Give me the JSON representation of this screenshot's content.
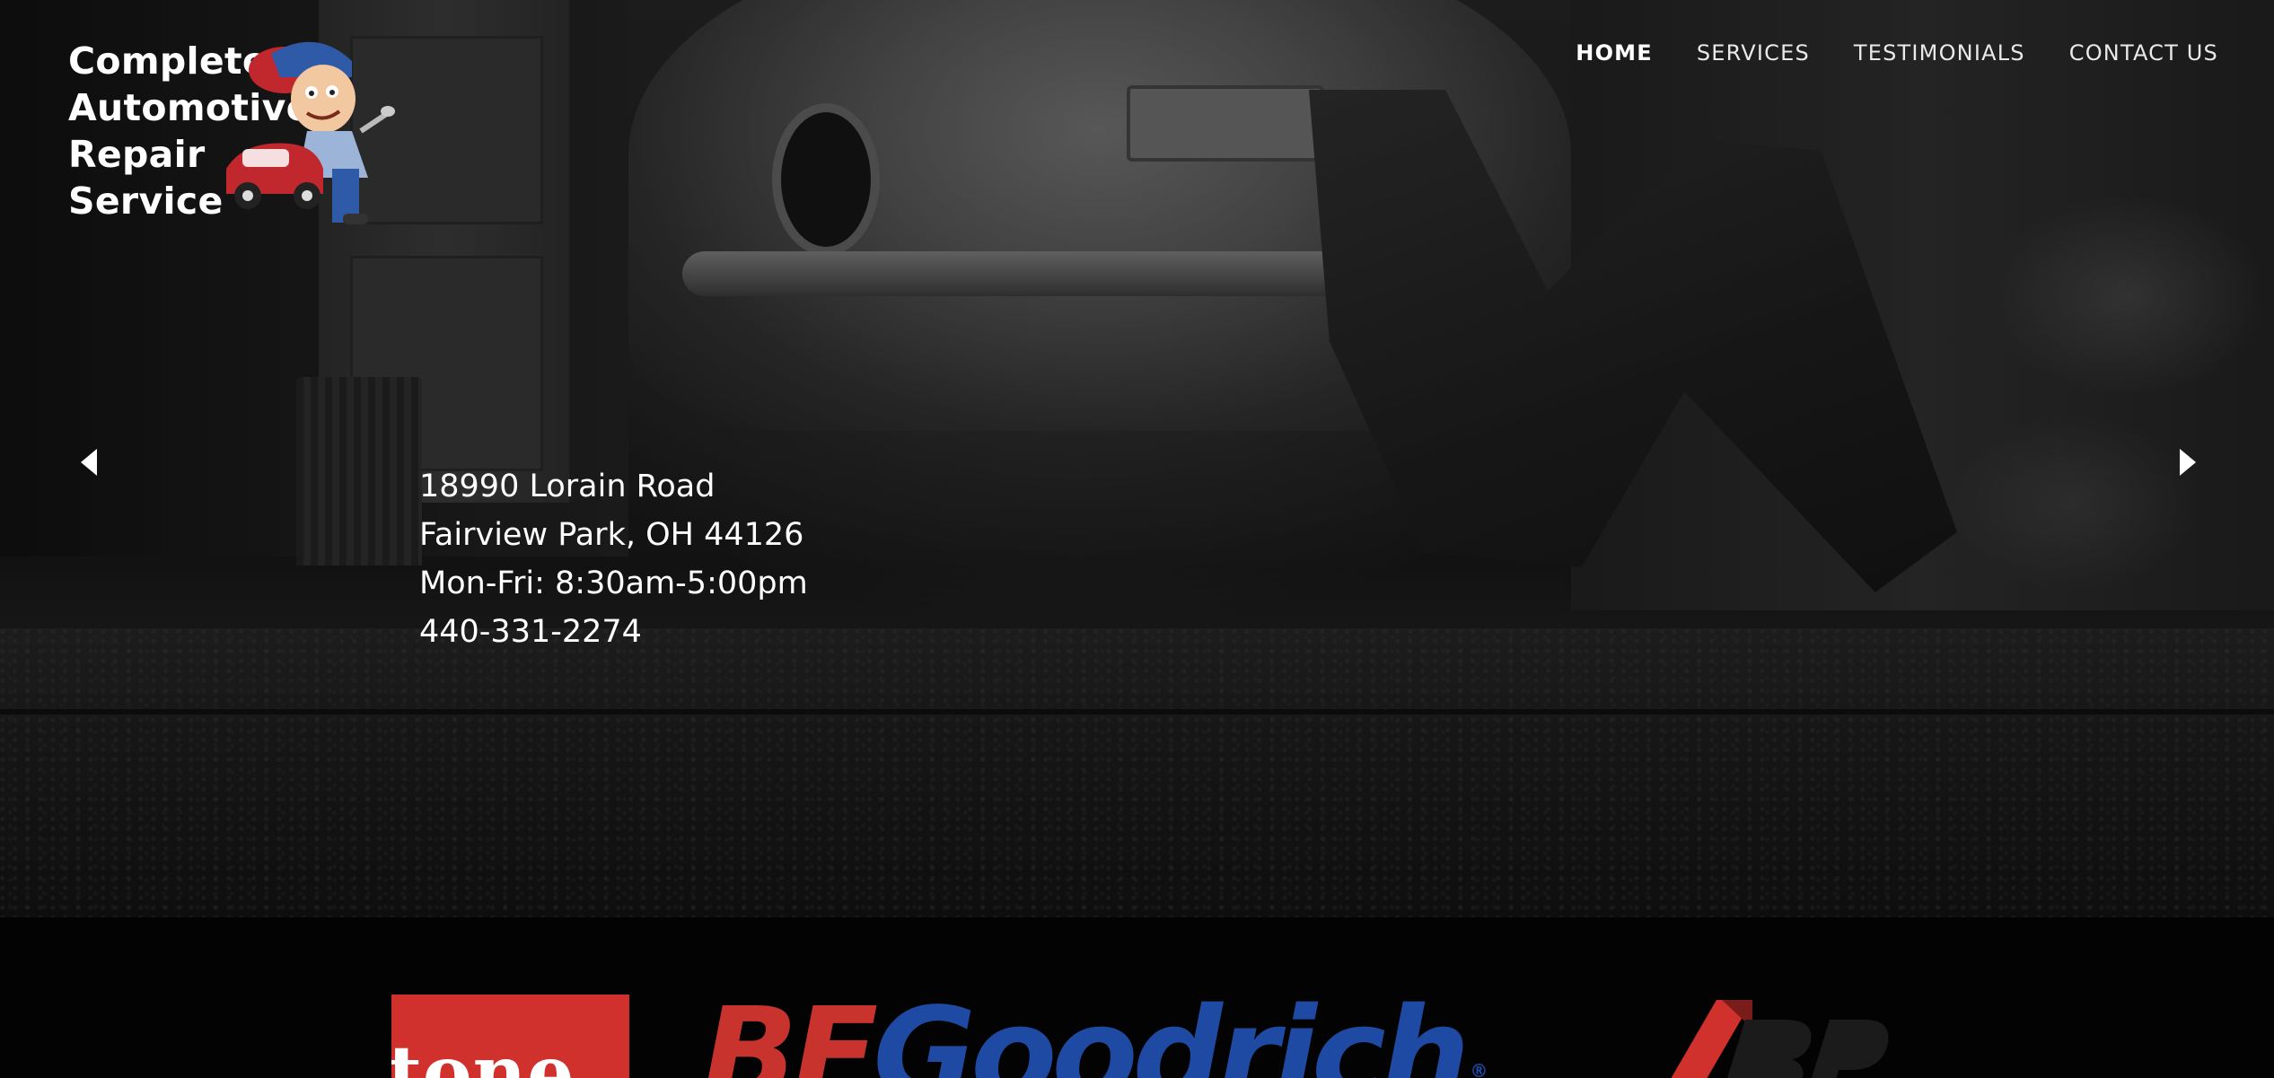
{
  "brand": {
    "logo_lines": [
      "Complete",
      "Automotive",
      "Repair",
      "Service"
    ]
  },
  "nav": {
    "items": [
      {
        "label": "HOME",
        "active": true
      },
      {
        "label": "SERVICES",
        "active": false
      },
      {
        "label": "TESTIMONIALS",
        "active": false
      },
      {
        "label": "CONTACT US",
        "active": false
      }
    ]
  },
  "slider": {
    "prev_icon": "triangle-left-icon",
    "next_icon": "triangle-right-icon"
  },
  "info": {
    "address_line1": "18990 Lorain Road",
    "address_line2": "Fairview Park, OH 44126",
    "hours": "Mon-Fri: 8:30am-5:00pm",
    "phone": "440-331-2274"
  },
  "brands": {
    "firestone_visible": "tone",
    "bfgoodrich_bf": "BF",
    "bfgoodrich_rest": "Goodrich",
    "bfgoodrich_mark": "®"
  },
  "colors": {
    "firestone_red": "#d0312d",
    "bfg_red": "#c8332e",
    "bfg_blue": "#1e4aa3",
    "bridgestone_red": "#d0312d",
    "mascot_red": "#c0282e",
    "mascot_blue": "#2e5aa8"
  }
}
